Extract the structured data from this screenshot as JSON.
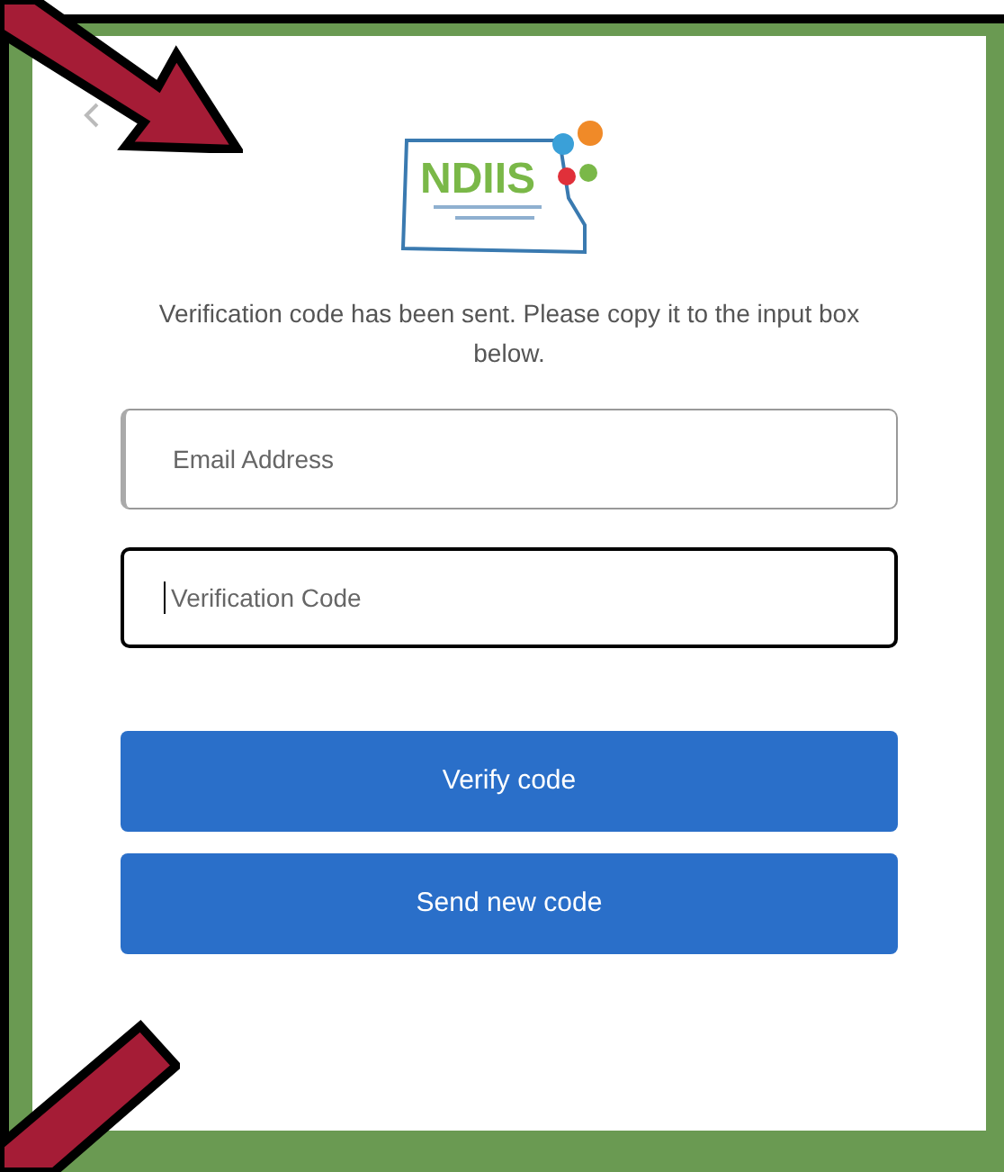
{
  "logo": {
    "text": "NDIIS"
  },
  "message": "Verification code has been sent. Please copy it to the input box below.",
  "fields": [
    {
      "placeholder": "Email Address",
      "focused": false
    },
    {
      "placeholder": "Verification Code",
      "focused": true
    }
  ],
  "buttons": [
    "Verify code",
    "Send new code"
  ]
}
